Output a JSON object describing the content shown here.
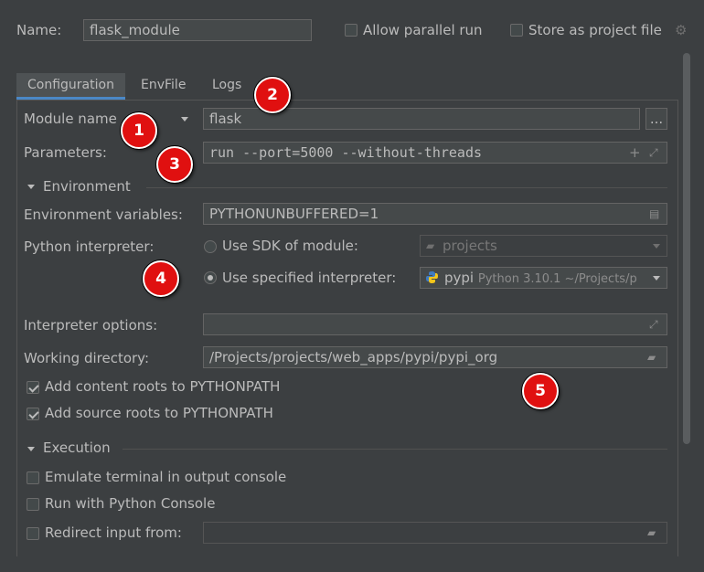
{
  "header": {
    "name_label": "Name:",
    "name_value": "flask_module",
    "allow_parallel_label": "Allow parallel run",
    "store_project_label": "Store as project file"
  },
  "tabs": [
    {
      "label": "Configuration",
      "active": true
    },
    {
      "label": "EnvFile",
      "active": false
    },
    {
      "label": "Logs",
      "active": false
    }
  ],
  "form": {
    "module_name_label": "Module name",
    "module_name_value": "flask",
    "browse_label": "...",
    "parameters_label": "Parameters:",
    "parameters_value": "run --port=5000 --without-threads",
    "environment_section": "Environment",
    "env_vars_label": "Environment variables:",
    "env_vars_value": "PYTHONUNBUFFERED=1",
    "python_interpreter_label": "Python interpreter:",
    "use_sdk_label": "Use SDK of module:",
    "sdk_value": "projects",
    "use_specified_label": "Use specified interpreter:",
    "interpreter_name": "pypi",
    "interpreter_detail": "Python 3.10.1 ~/Projects/p",
    "interpreter_options_label": "Interpreter options:",
    "interpreter_options_value": "",
    "working_dir_label": "Working directory:",
    "working_dir_value": "/Projects/projects/web_apps/pypi/pypi_org",
    "add_content_roots_label": "Add content roots to PYTHONPATH",
    "add_source_roots_label": "Add source roots to PYTHONPATH",
    "execution_section": "Execution",
    "emulate_terminal_label": "Emulate terminal in output console",
    "run_python_console_label": "Run with Python Console",
    "redirect_input_label": "Redirect input from:",
    "redirect_input_value": ""
  },
  "badges": [
    "1",
    "2",
    "3",
    "4",
    "5"
  ],
  "colors": {
    "background": "#3c3f41",
    "field": "#45494a",
    "accent": "#4a88c7",
    "badge": "#e01010"
  }
}
